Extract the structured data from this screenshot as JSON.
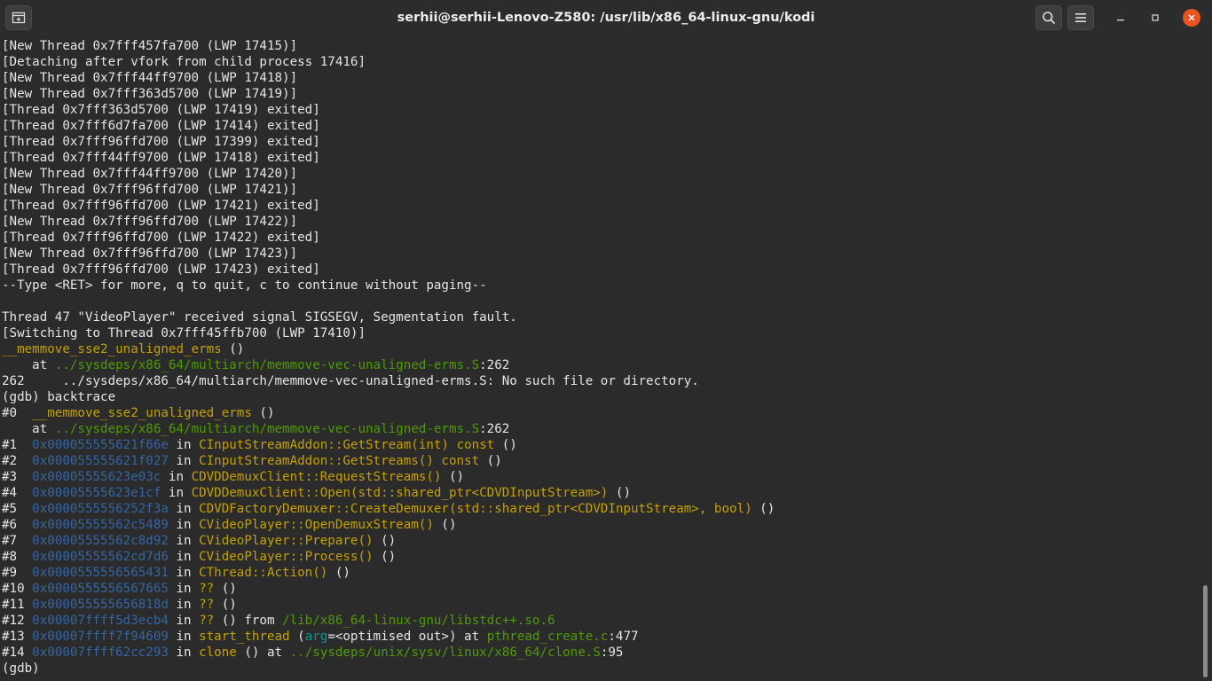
{
  "window": {
    "title": "serhii@serhii-Lenovo-Z580: /usr/lib/x86_64-linux-gnu/kodi"
  },
  "icons": {
    "new_tab": "new-tab-icon",
    "search": "search-icon",
    "menu": "hamburger-menu-icon",
    "minimize": "minimize-icon",
    "maximize": "maximize-icon",
    "close": "close-icon"
  },
  "colors": {
    "function": "#c4a000",
    "address": "#3465a4",
    "path": "#4e9a06",
    "variable": "#06989a",
    "close_button": "#e95420"
  },
  "terminal": {
    "plain_lines": [
      "[New Thread 0x7fff457fa700 (LWP 17415)]",
      "[Detaching after vfork from child process 17416]",
      "[New Thread 0x7fff44ff9700 (LWP 17418)]",
      "[New Thread 0x7fff363d5700 (LWP 17419)]",
      "[Thread 0x7fff363d5700 (LWP 17419) exited]",
      "[Thread 0x7fff6d7fa700 (LWP 17414) exited]",
      "[Thread 0x7fff96ffd700 (LWP 17399) exited]",
      "[Thread 0x7fff44ff9700 (LWP 17418) exited]",
      "[New Thread 0x7fff44ff9700 (LWP 17420)]",
      "[New Thread 0x7fff96ffd700 (LWP 17421)]",
      "[Thread 0x7fff96ffd700 (LWP 17421) exited]",
      "[New Thread 0x7fff96ffd700 (LWP 17422)]",
      "[Thread 0x7fff96ffd700 (LWP 17422) exited]",
      "[New Thread 0x7fff96ffd700 (LWP 17423)]",
      "[Thread 0x7fff96ffd700 (LWP 17423) exited]",
      "--Type <RET> for more, q to quit, c to continue without paging--",
      "",
      "Thread 47 \"VideoPlayer\" received signal SIGSEGV, Segmentation fault.",
      "[Switching to Thread 0x7fff45ffb700 (LWP 17410)]"
    ],
    "crash": {
      "function": "__memmove_sse2_unaligned_erms",
      "function_suffix": " ()",
      "at_prefix": "    at ",
      "file": "../sysdeps/x86_64/multiarch/memmove-vec-unaligned-erms.S",
      "file_line": ":262",
      "no_source": "262\t../sysdeps/x86_64/multiarch/memmove-vec-unaligned-erms.S: No such file or directory.",
      "no_source_display": "262     ../sysdeps/x86_64/multiarch/memmove-vec-unaligned-erms.S: No such file or directory.",
      "command": "(gdb) backtrace"
    },
    "frame0": {
      "num": "#0  ",
      "function": "__memmove_sse2_unaligned_erms",
      "function_suffix": " ()",
      "at_prefix": "    at ",
      "file": "../sysdeps/x86_64/multiarch/memmove-vec-unaligned-erms.S",
      "file_line": ":262"
    },
    "frames": [
      {
        "num": "#1  ",
        "addr": "0x000055555621f66e",
        "in": " in ",
        "func": "CInputStreamAddon::GetStream(int) const",
        "rest": " ()"
      },
      {
        "num": "#2  ",
        "addr": "0x000055555621f027",
        "in": " in ",
        "func": "CInputStreamAddon::GetStreams() const",
        "rest": " ()"
      },
      {
        "num": "#3  ",
        "addr": "0x00005555623e03c",
        "in": " in ",
        "func": "CDVDDemuxClient::RequestStreams()",
        "rest": " ()"
      },
      {
        "num": "#4  ",
        "addr": "0x00005555623e1cf",
        "in": " in ",
        "func": "CDVDDemuxClient::Open(std::shared_ptr<CDVDInputStream>)",
        "rest": " ()"
      },
      {
        "num": "#5  ",
        "addr": "0x0000555556252f3a",
        "in": " in ",
        "func": "CDVDFactoryDemuxer::CreateDemuxer(std::shared_ptr<CDVDInputStream>, bool)",
        "rest": " ()"
      },
      {
        "num": "#6  ",
        "addr": "0x00005555562c5489",
        "in": " in ",
        "func": "CVideoPlayer::OpenDemuxStream()",
        "rest": " ()"
      },
      {
        "num": "#7  ",
        "addr": "0x00005555562c8d92",
        "in": " in ",
        "func": "CVideoPlayer::Prepare()",
        "rest": " ()"
      },
      {
        "num": "#8  ",
        "addr": "0x00005555562cd7d6",
        "in": " in ",
        "func": "CVideoPlayer::Process()",
        "rest": " ()"
      },
      {
        "num": "#9  ",
        "addr": "0x0000555556565431",
        "in": " in ",
        "func": "CThread::Action()",
        "rest": " ()"
      },
      {
        "num": "#10 ",
        "addr": "0x0000555556567665",
        "in": " in ",
        "func": "??",
        "rest": " ()"
      },
      {
        "num": "#11 ",
        "addr": "0x000055555656818d",
        "in": " in ",
        "func": "??",
        "rest": " ()"
      }
    ],
    "frame12": {
      "num": "#12 ",
      "addr": "0x00007ffff5d3ecb4",
      "in": " in ",
      "func": "??",
      "mid": " () from ",
      "lib": "/lib/x86_64-linux-gnu/libstdc++.so.6"
    },
    "frame13": {
      "num": "#13 ",
      "addr": "0x00007ffff7f94609",
      "in": " in ",
      "func": "start_thread",
      "paren_open": " (",
      "arg": "arg",
      "arg_val": "=<optimised out>) at ",
      "file": "pthread_create.c",
      "file_line": ":477"
    },
    "frame14": {
      "num": "#14 ",
      "addr": "0x00007ffff62cc293",
      "in": " in ",
      "func": "clone",
      "mid": " () at ",
      "file": "../sysdeps/unix/sysv/linux/x86_64/clone.S",
      "file_line": ":95"
    },
    "prompt": "(gdb)"
  }
}
